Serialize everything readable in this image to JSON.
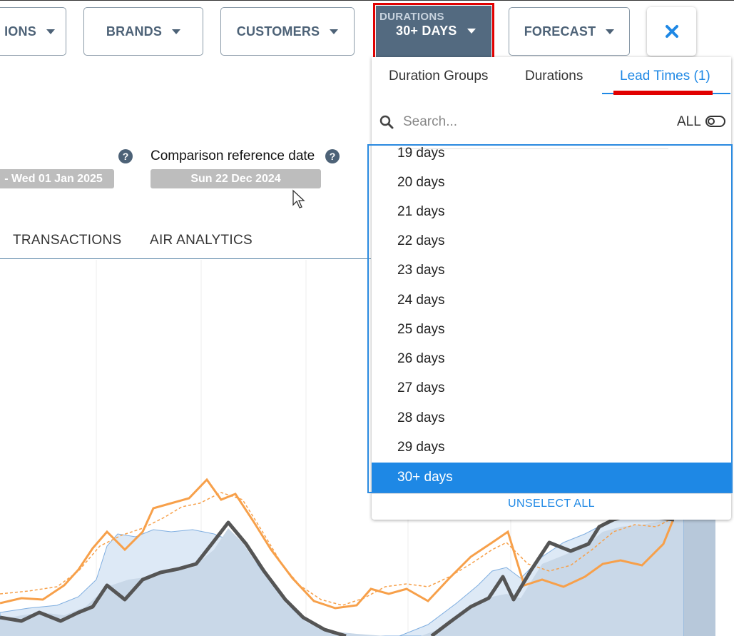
{
  "filters": {
    "first_label": "IONS",
    "brands_label": "BRANDS",
    "customers_label": "CUSTOMERS",
    "durations_sub": "DURATIONS",
    "durations_value": "30+ DAYS",
    "forecast_label": "FORECAST"
  },
  "dates": {
    "range_end": "- Wed 01 Jan 2025",
    "comparison_label": "Comparison reference date",
    "comparison_value": "Sun 22 Dec 2024",
    "help_glyph": "?"
  },
  "page_tabs": [
    "TRANSACTIONS",
    "AIR ANALYTICS"
  ],
  "dropdown": {
    "tabs": [
      "Duration Groups",
      "Durations",
      "Lead Times (1)"
    ],
    "selected_tab": "Lead Times (1)",
    "search_placeholder": "Search...",
    "all_label": "ALL",
    "items": [
      "19 days",
      "20 days",
      "21 days",
      "22 days",
      "23 days",
      "24 days",
      "25 days",
      "26 days",
      "27 days",
      "28 days",
      "29 days",
      "30+ days"
    ],
    "selected_item": "30+ days",
    "unselect_label": "UNSELECT ALL"
  },
  "colors": {
    "accent": "#1e88e5",
    "filter_active": "#536a80",
    "highlight_red": "#e10000",
    "series_orange": "#f7a04a",
    "series_dark": "#555555",
    "area_fill": "#c9d8e8"
  },
  "icons": {
    "close": "close-icon",
    "search": "search-icon",
    "caret": "caret-down-icon"
  }
}
